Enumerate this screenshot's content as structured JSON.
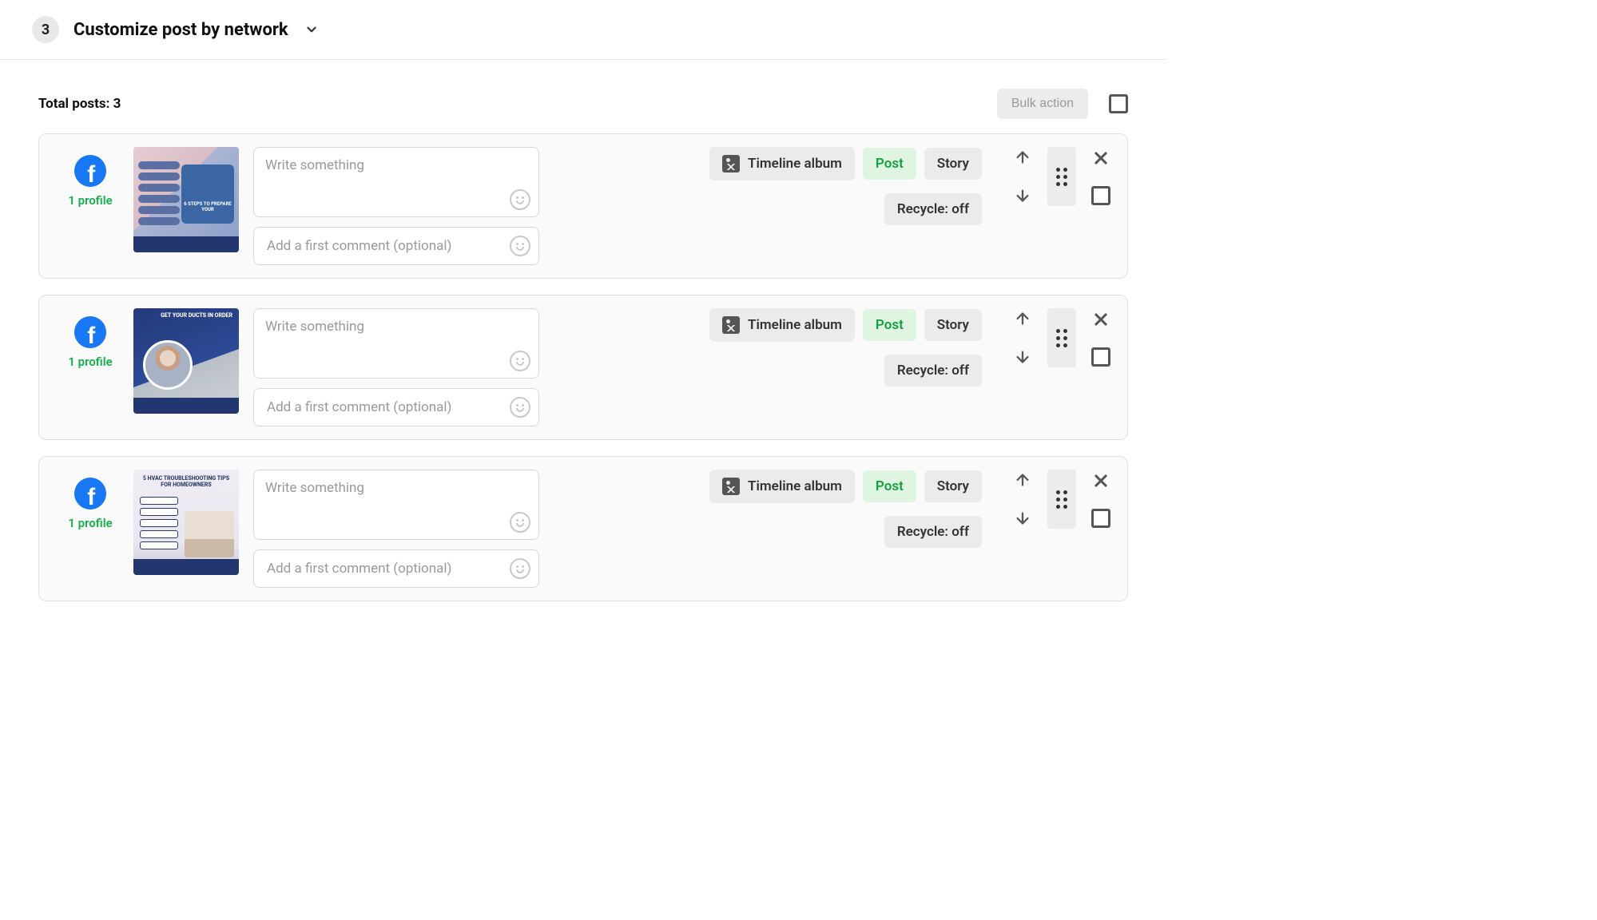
{
  "header": {
    "step_number": "3",
    "title": "Customize post by network"
  },
  "subheader": {
    "total_label": "Total posts: 3",
    "bulk_action_label": "Bulk action"
  },
  "common": {
    "write_placeholder": "Write something",
    "comment_placeholder": "Add a first comment (optional)",
    "timeline_album_label": "Timeline album",
    "post_label": "Post",
    "story_label": "Story",
    "recycle_label": "Recycle: off",
    "profile_label": "1 profile"
  },
  "cards": [
    {
      "network": "facebook",
      "profile_count": "1 profile",
      "thumb_hint": "6 STEPS TO PREPARE YOUR",
      "recycle": "Recycle: off"
    },
    {
      "network": "facebook",
      "profile_count": "1 profile",
      "thumb_hint": "GET YOUR DUCTS IN ORDER",
      "recycle": "Recycle: off"
    },
    {
      "network": "facebook",
      "profile_count": "1 profile",
      "thumb_hint": "5 HVAC TROUBLESHOOTING TIPS FOR HOMEOWNERS",
      "recycle": "Recycle: off"
    }
  ]
}
